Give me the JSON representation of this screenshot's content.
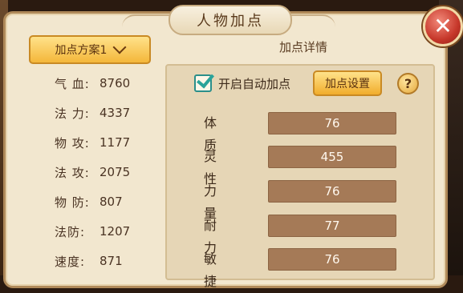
{
  "window": {
    "title": "人物加点",
    "close_glyph": "✕"
  },
  "scheme": {
    "selected": "加点方案1"
  },
  "stats": [
    {
      "label": "气 血:",
      "value": "8760"
    },
    {
      "label": "法 力:",
      "value": "4337"
    },
    {
      "label": "物 攻:",
      "value": "1177"
    },
    {
      "label": "法 攻:",
      "value": "2075"
    },
    {
      "label": "物 防:",
      "value": "807"
    },
    {
      "label": "法防:",
      "value": "1207"
    },
    {
      "label": "速度:",
      "value": "871"
    }
  ],
  "details": {
    "heading": "加点详情",
    "auto_label": "开启自动加点",
    "auto_checked": true,
    "settings_label": "加点设置",
    "help_glyph": "?",
    "attributes": [
      {
        "name": "体质",
        "value": "76"
      },
      {
        "name": "灵性",
        "value": "455"
      },
      {
        "name": "力量",
        "value": "76"
      },
      {
        "name": "耐力",
        "value": "77"
      },
      {
        "name": "敏捷",
        "value": "76"
      }
    ]
  },
  "colors": {
    "panel_bg": "#f2e7cf",
    "gold_button": "#f4b73a",
    "attr_bar": "#a57a57",
    "close_red": "#c6372a",
    "check_teal": "#2aa39a"
  },
  "icons": {
    "close": "close-icon",
    "dropdown": "chevron-down-icon",
    "check": "checkmark-icon",
    "help": "question-icon"
  }
}
